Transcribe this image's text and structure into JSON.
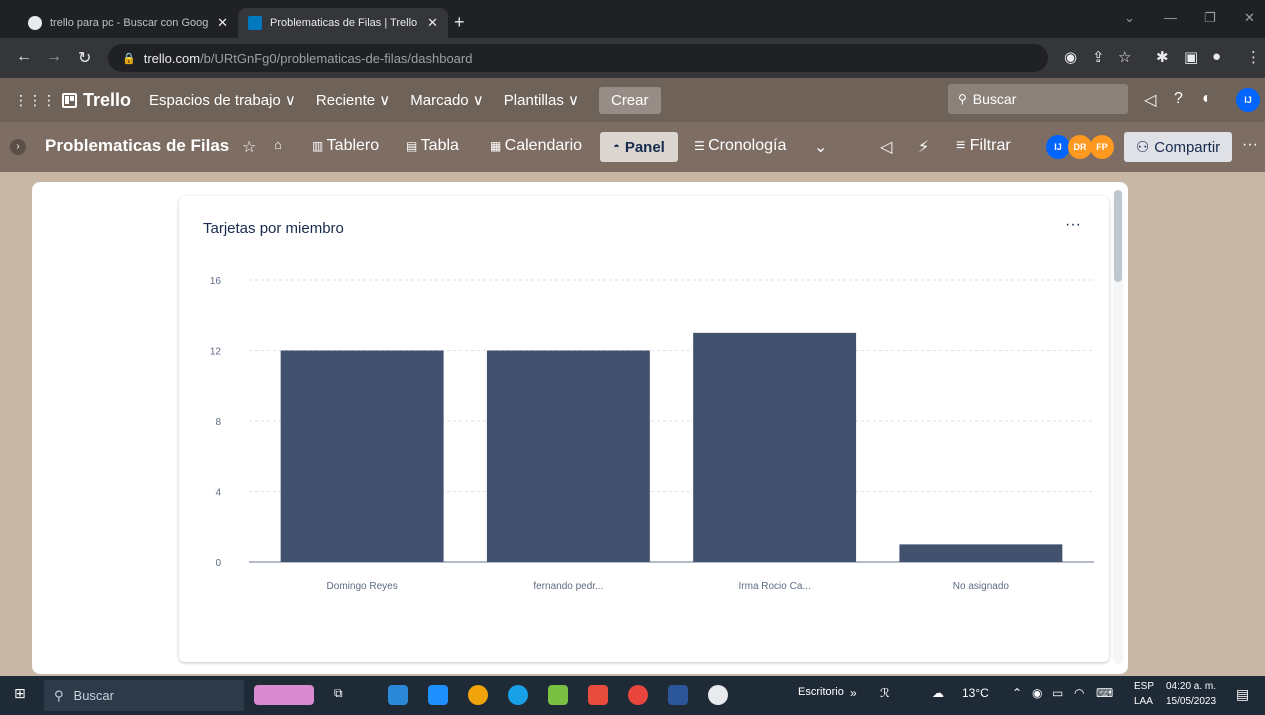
{
  "browser": {
    "tabs": [
      {
        "title": "trello para pc - Buscar con Googl"
      },
      {
        "title": "Problematicas de Filas | Trello"
      }
    ],
    "url_host": "trello.com",
    "url_path": "/b/URtGnFg0/problematicas-de-filas/dashboard"
  },
  "header": {
    "logo": "Trello",
    "nav": [
      "Espacios de trabajo ∨",
      "Reciente ∨",
      "Marcado ∨",
      "Plantillas ∨"
    ],
    "create": "Crear",
    "search": "Buscar"
  },
  "board": {
    "title": "Problematicas de Filas",
    "views": [
      "Tablero",
      "Tabla",
      "Calendario"
    ],
    "active_view": "Panel",
    "timeline": "Cronología",
    "filter": "Filtrar",
    "share": "Compartir",
    "members": [
      "IJ",
      "DR",
      "FP"
    ]
  },
  "card": {
    "title": "Tarjetas por miembro"
  },
  "chart_data": {
    "type": "bar",
    "categories": [
      "Domingo Reyes",
      "fernando pedr...",
      "Irma Rocio Ca...",
      "No asignado"
    ],
    "values": [
      12,
      12,
      13,
      1
    ],
    "yticks": [
      0,
      4,
      8,
      12,
      16
    ],
    "ylim": [
      0,
      16
    ],
    "bar_color": "#42526e",
    "grid": "dashed horizontal"
  },
  "taskbar": {
    "search": "Buscar",
    "desktop": "Escritorio",
    "weather": "13°C",
    "lang_top": "ESP",
    "lang_bottom": "LAA",
    "time": "04:20 a. m.",
    "date": "15/05/2023"
  }
}
